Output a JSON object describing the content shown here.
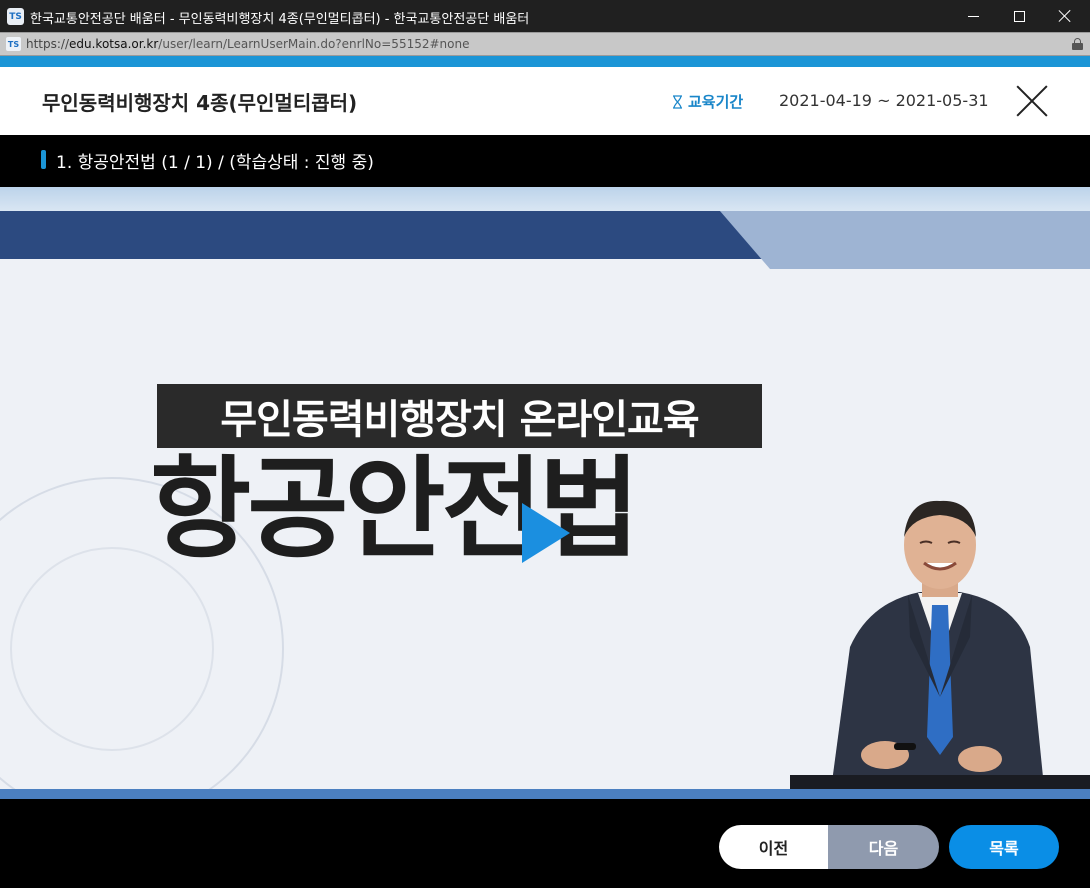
{
  "window": {
    "icon_text": "TS",
    "title": "한국교통안전공단 배움터 - 무인동력비행장치 4종(무인멀티콥터) - 한국교통안전공단 배움터"
  },
  "address": {
    "scheme": "https://",
    "host": "edu.kotsa.or.kr",
    "path": "/user/learn/LearnUserMain.do?enrlNo=55152#none"
  },
  "header": {
    "course_title": "무인동력비행장치 4종(무인멀티콥터)",
    "period_label": "교육기간",
    "period_value": "2021-04-19 ~ 2021-05-31"
  },
  "lesson": {
    "text": "1. 항공안전법 (1 / 1) / (학습상태 : 진행 중)"
  },
  "video": {
    "subtitle": "무인동력비행장치 온라인교육",
    "main_title": "항공안전법"
  },
  "controls": {
    "prev_label": "이전",
    "next_label": "다음",
    "list_label": "목록"
  },
  "colors": {
    "accent": "#1b95d6",
    "list_button": "#0a8ee6",
    "next_button": "#8f9aae"
  }
}
